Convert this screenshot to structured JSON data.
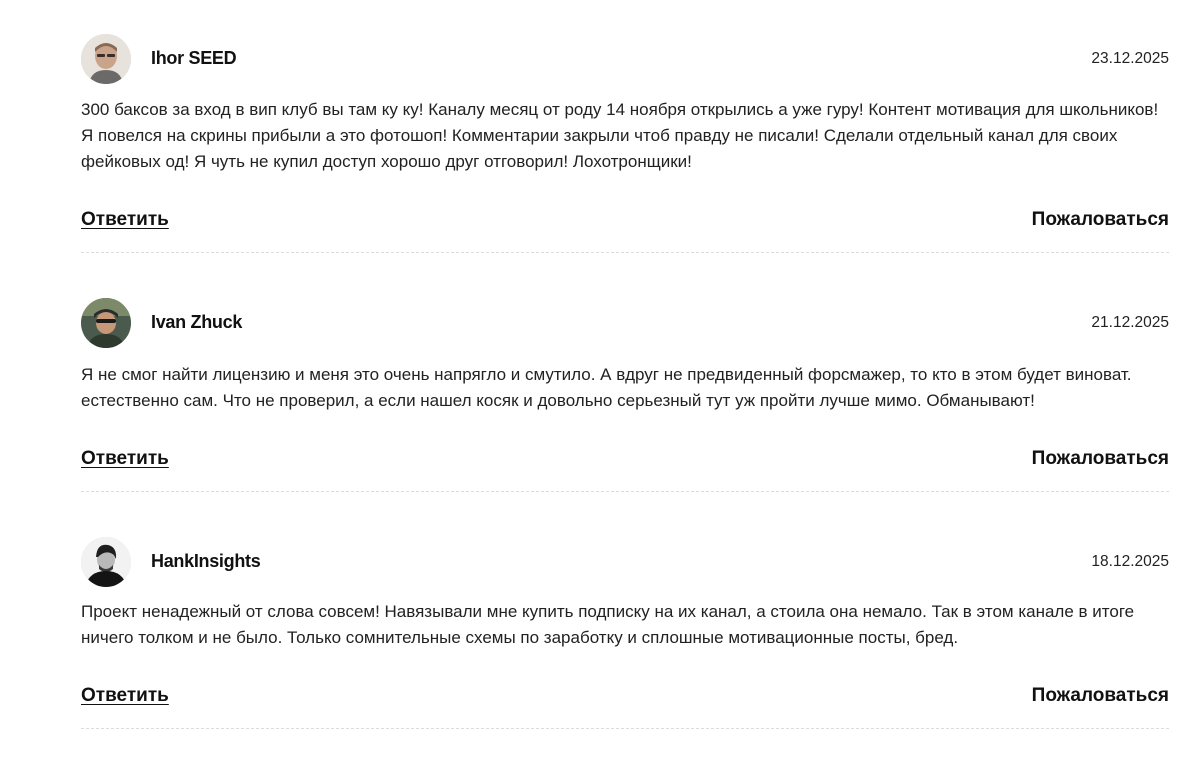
{
  "comments": [
    {
      "author": "Ihor SEED",
      "date": "23.12.2025",
      "text": "300 баксов за вход в вип клуб вы там ку ку! Каналу месяц от роду 14 ноября открылись а уже гуру! Контент мотивация для школьников! Я повелся на скрины прибыли а это фотошоп! Комментарии закрыли чтоб правду не писали! Сделали отдельный канал для своих фейковых од! Я чуть не купил доступ хорошо друг отговорил! Лохотронщики!",
      "reply_label": "Ответить",
      "report_label": "Пожаловаться"
    },
    {
      "author": "Ivan Zhuck",
      "date": "21.12.2025",
      "text": "Я не смог найти лицензию и меня это очень напрягло и смутило. А вдруг не предвиденный форсмажер, то кто в этом будет виноват. естественно сам. Что не проверил, а если нашел косяк и довольно серьезный тут уж пройти лучше мимо. Обманывают!",
      "reply_label": "Ответить",
      "report_label": "Пожаловаться"
    },
    {
      "author": "HankInsights",
      "date": "18.12.2025",
      "text": "Проект ненадежный от слова совсем! Навязывали мне купить подписку на их канал, а стоила она немало. Так в этом канале в итоге ничего толком и не было. Только сомнительные схемы по заработку и сплошные мотивационные посты, бред.",
      "reply_label": "Ответить",
      "report_label": "Пожаловаться"
    }
  ]
}
